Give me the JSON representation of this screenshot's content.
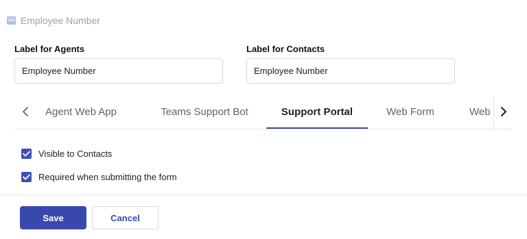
{
  "field": {
    "icon": "number-field-icon",
    "icon_text": "123",
    "name": "Employee Number"
  },
  "labels": {
    "agents": {
      "title": "Label for Agents",
      "value": "Employee Number"
    },
    "contacts": {
      "title": "Label for Contacts",
      "value": "Employee Number"
    }
  },
  "tabs": {
    "items": [
      {
        "label": "Agent Web App"
      },
      {
        "label": "Teams Support Bot"
      },
      {
        "label": "Support Portal"
      },
      {
        "label": "Web Form"
      },
      {
        "label": "Web"
      }
    ],
    "active": "Support Portal",
    "prev_icon": "chevron-left-icon",
    "next_icon": "chevron-right-icon"
  },
  "options": [
    {
      "label": "Visible to Contacts",
      "checked": true
    },
    {
      "label": "Required when submitting the form",
      "checked": true
    }
  ],
  "actions": {
    "save_label": "Save",
    "cancel_label": "Cancel"
  },
  "colors": {
    "accent": "#3949ab",
    "checkbox": "#3f51b5",
    "muted_text": "#9aa0a6"
  }
}
